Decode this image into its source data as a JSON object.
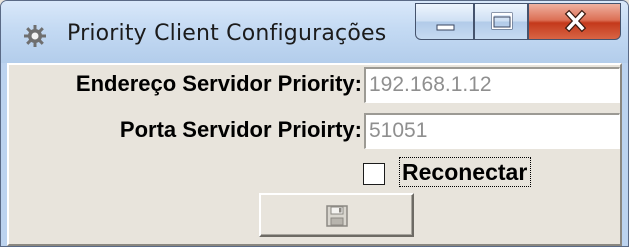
{
  "window": {
    "title": "Priority Client Configurações",
    "icon": "gear-icon"
  },
  "caption_buttons": {
    "minimize_icon": "minimize-icon",
    "maximize_icon": "maximize-icon",
    "close_icon": "close-icon"
  },
  "form": {
    "server_address_label": "Endereço Servidor Priority:",
    "server_address_value": "192.168.1.12",
    "server_port_label": "Porta Servidor Prioirty:",
    "server_port_value": "51051",
    "reconnect_label": "Reconectar",
    "reconnect_checked": false,
    "save_button_icon": "floppy-disk-icon"
  },
  "colors": {
    "title_bar": "#c4daf3",
    "close_button": "#c4391b",
    "dialog_background": "#e8e4dc",
    "field_text": "#8f8f8f"
  }
}
